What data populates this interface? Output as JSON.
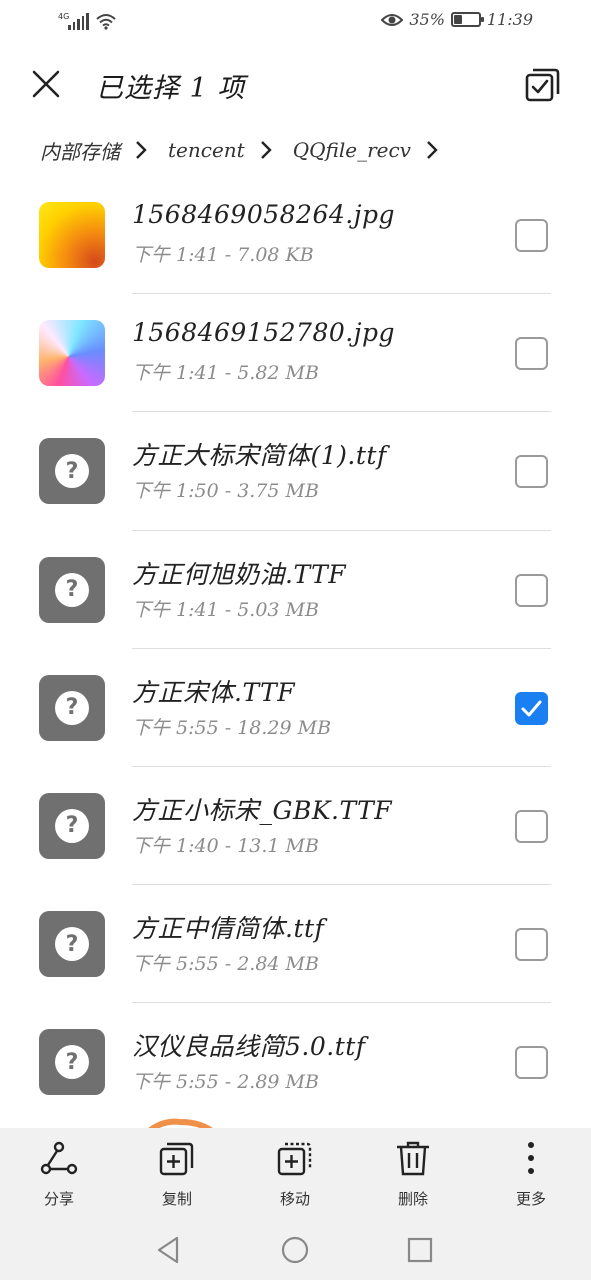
{
  "status_bar": {
    "network": "4G",
    "battery_percent": "35%",
    "battery_level": 0.35,
    "time": "11:39",
    "icons": [
      "signal-icon",
      "wifi-icon",
      "eye-icon",
      "battery-icon"
    ]
  },
  "header": {
    "title": "已选择 1 项",
    "close_icon": "close-icon",
    "select_all_icon": "select-all-icon"
  },
  "breadcrumb": [
    "内部存储",
    "tencent",
    "QQfile_recv"
  ],
  "files": [
    {
      "name": "1568469058264.jpg",
      "meta": "下午 1:41 - 7.08 KB",
      "thumb": "orange-image",
      "checked": false
    },
    {
      "name": "1568469152780.jpg",
      "meta": "下午 1:41 - 5.82 MB",
      "thumb": "holo-image",
      "checked": false
    },
    {
      "name": "方正大标宋简体(1).ttf",
      "meta": "下午 1:50 - 3.75 MB",
      "thumb": "unknown-file",
      "checked": false
    },
    {
      "name": "方正何旭奶油.TTF",
      "meta": "下午 1:41 - 5.03 MB",
      "thumb": "unknown-file",
      "checked": false
    },
    {
      "name": "方正宋体.TTF",
      "meta": "下午 5:55 - 18.29 MB",
      "thumb": "unknown-file",
      "checked": true
    },
    {
      "name": "方正小标宋_GBK.TTF",
      "meta": "下午 1:40 - 13.1 MB",
      "thumb": "unknown-file",
      "checked": false
    },
    {
      "name": "方正中倩简体.ttf",
      "meta": "下午 5:55 - 2.84 MB",
      "thumb": "unknown-file",
      "checked": false
    },
    {
      "name": "汉仪良品线简5.0.ttf",
      "meta": "下午 5:55 - 2.89 MB",
      "thumb": "unknown-file",
      "checked": false
    }
  ],
  "toolbar": {
    "share": "分享",
    "copy": "复制",
    "move": "移动",
    "delete": "删除",
    "more": "更多"
  },
  "annotation": {
    "color": "#f0914a",
    "target": "copy"
  },
  "colors": {
    "accent": "#1a7ff0",
    "toolbar_bg": "#f1f1f1"
  }
}
